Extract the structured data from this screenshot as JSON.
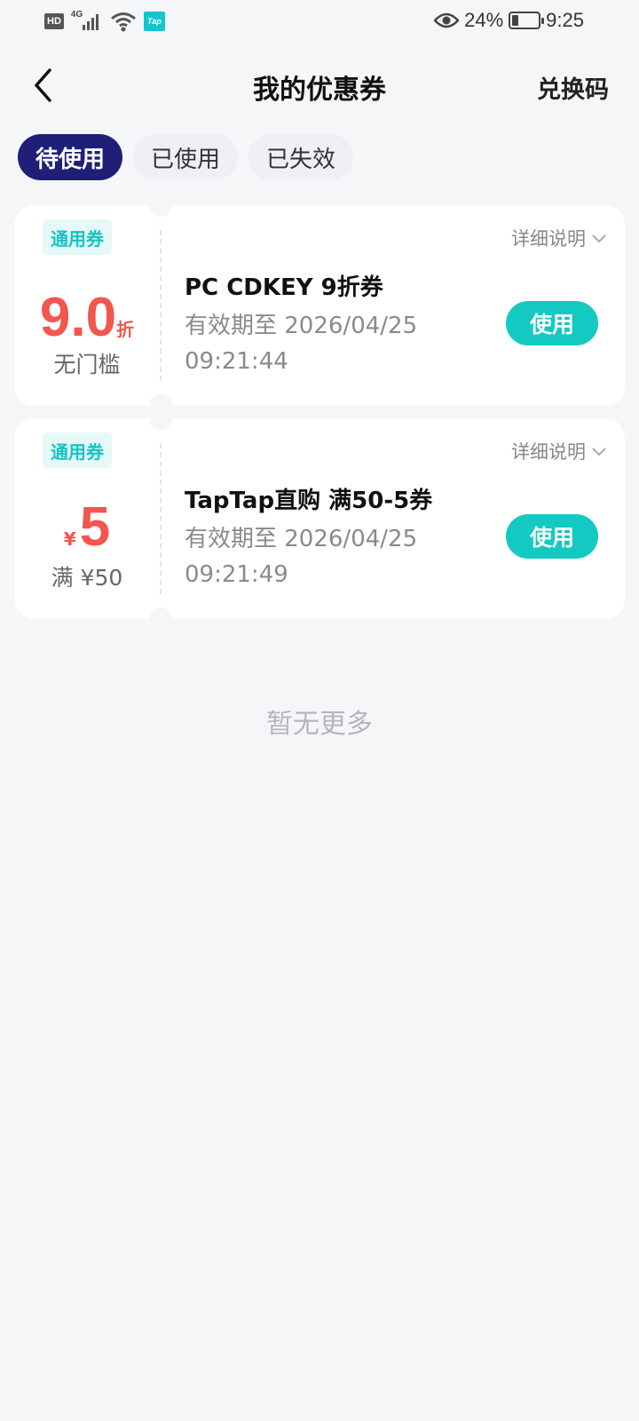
{
  "status_bar": {
    "hd": "HD",
    "network": "4G",
    "tap_badge": "Tap",
    "battery": "24%",
    "battery_level": 0.24,
    "time": "9:25"
  },
  "header": {
    "title": "我的优惠券",
    "redeem_label": "兑换码"
  },
  "tabs": [
    {
      "label": "待使用",
      "active": true
    },
    {
      "label": "已使用",
      "active": false
    },
    {
      "label": "已失效",
      "active": false
    }
  ],
  "coupons": [
    {
      "tag": "通用券",
      "value": "9.0",
      "unit": "折",
      "condition": "无门槛",
      "details_label": "详细说明",
      "title": "PC CDKEY 9折券",
      "validity": "有效期至 2026/04/25 09:21:44",
      "use_label": "使用"
    },
    {
      "tag": "通用券",
      "currency": "¥",
      "value": "5",
      "condition": "满 ¥50",
      "details_label": "详细说明",
      "title": "TapTap直购 满50-5券",
      "validity": "有效期至 2026/04/25 09:21:49",
      "use_label": "使用"
    }
  ],
  "footer": {
    "no_more": "暂无更多"
  },
  "colors": {
    "active_tab": "#1f1f78",
    "accent": "#14c9c1",
    "value_red": "#f2564e",
    "tag_text": "#16c3c6"
  }
}
